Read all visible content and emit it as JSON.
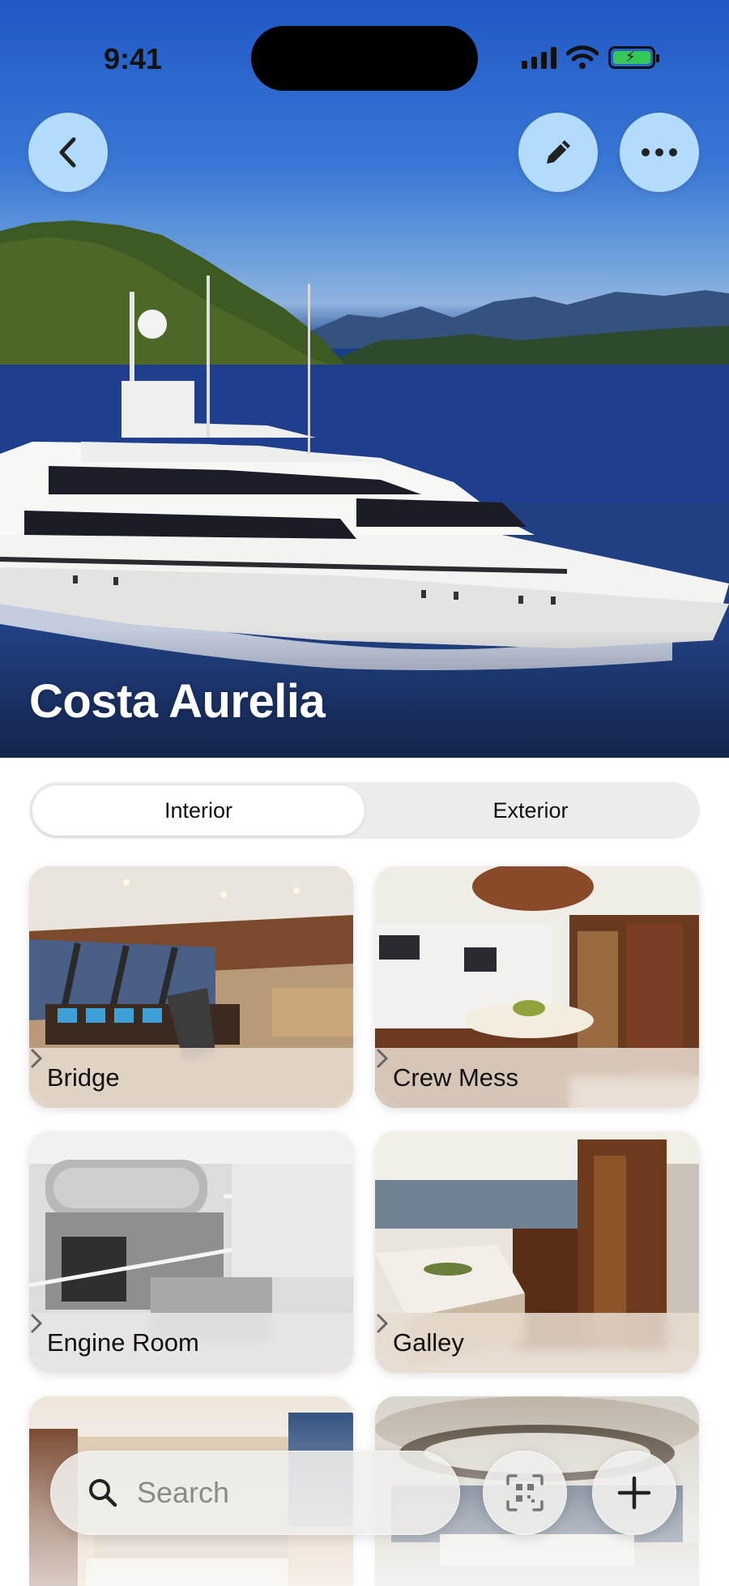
{
  "status_bar": {
    "time": "9:41",
    "icons": [
      "cellular-signal-icon",
      "wifi-icon",
      "battery-charging-icon"
    ]
  },
  "header": {
    "title": "Costa Aurelia",
    "actions": [
      {
        "name": "back",
        "icon": "chevron-left-icon"
      },
      {
        "name": "edit",
        "icon": "pencil-icon"
      },
      {
        "name": "more",
        "icon": "ellipsis-icon"
      }
    ]
  },
  "segmented": {
    "options": [
      "Interior",
      "Exterior"
    ],
    "selected": "Interior"
  },
  "rooms": [
    {
      "label": "Bridge"
    },
    {
      "label": "Crew Mess"
    },
    {
      "label": "Engine Room"
    },
    {
      "label": "Galley"
    },
    {
      "label": ""
    },
    {
      "label": ""
    }
  ],
  "bottom_bar": {
    "search_placeholder": "Search",
    "icons": [
      "search-icon",
      "qr-scan-icon",
      "plus-icon"
    ]
  },
  "colors": {
    "button_tint": "#BEE4FF",
    "battery_green": "#35C759",
    "card_label_bg": "#E8DCD0"
  }
}
